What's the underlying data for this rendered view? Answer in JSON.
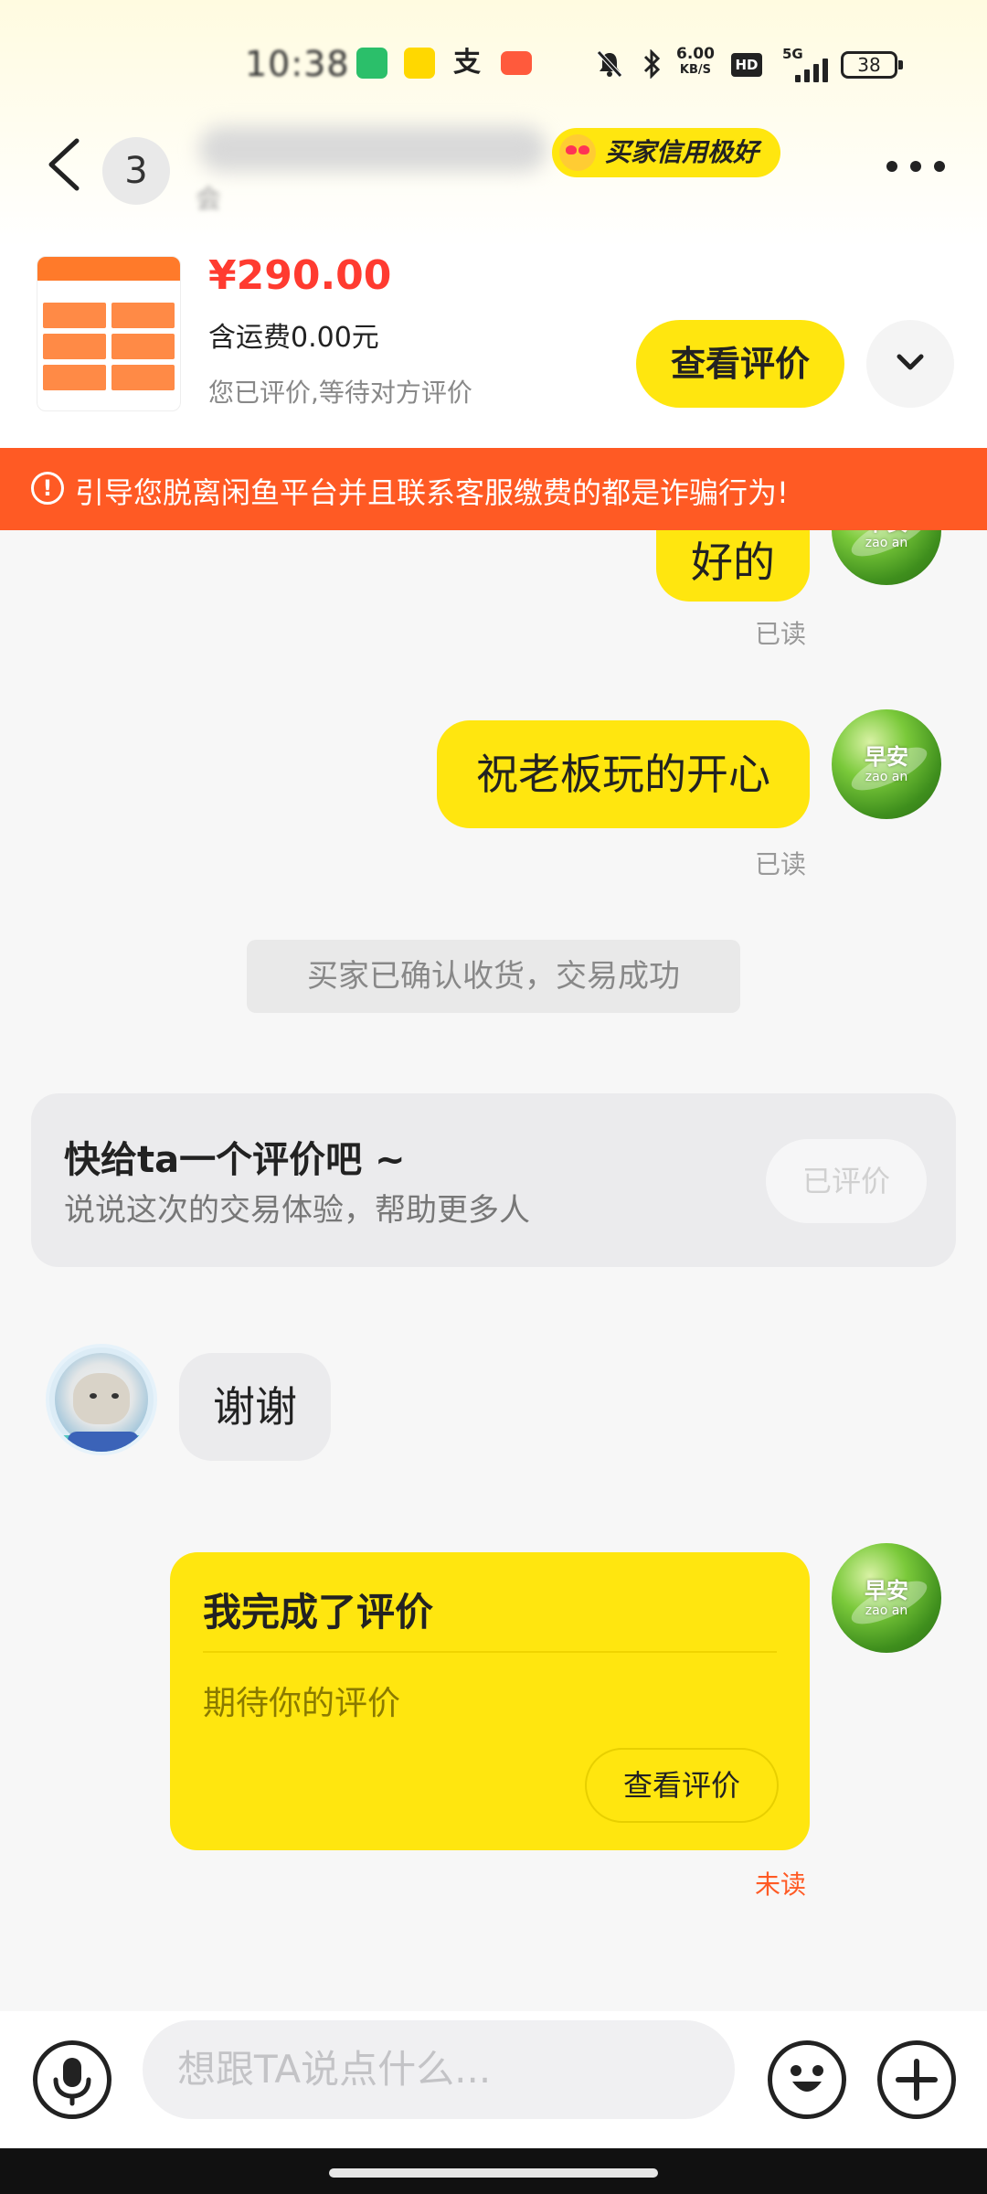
{
  "status_bar": {
    "time": "10:38",
    "net_speed_value": "6.00",
    "net_speed_unit": "KB/S",
    "hd_label": "HD",
    "network": "5G",
    "battery": "38"
  },
  "nav": {
    "unread_count": "3",
    "nickname_sub": "会",
    "credit_badge": "买家信用极好"
  },
  "product": {
    "price": "¥290.00",
    "shipping": "含运费0.00元",
    "status": "您已评价,等待对方评价",
    "view_review_label": "查看评价"
  },
  "warning": {
    "icon": "!",
    "text": "引导您脱离闲鱼平台并且联系客服缴费的都是诈骗行为!"
  },
  "messages": {
    "m1_text": "好的",
    "m1_read": "已读",
    "m2_text": "祝老板玩的开心",
    "m2_read": "已读",
    "avatar_me_text": "早安",
    "avatar_me_sub": "zao an",
    "system_msg": "买家已确认收货，交易成功",
    "review_prompt_title": "快给ta一个评价吧 ~",
    "review_prompt_sub": "说说这次的交易体验，帮助更多人",
    "review_prompt_button": "已评价",
    "m3_text": "谢谢",
    "done_card_title": "我完成了评价",
    "done_card_sub": "期待你的评价",
    "done_card_button": "查看评价",
    "done_card_status": "未读"
  },
  "input": {
    "placeholder": "想跟TA说点什么..."
  },
  "icons": {
    "back": "chevron-left-icon",
    "more": "more-dots-icon",
    "expand": "chevron-down-icon",
    "voice": "microphone-icon",
    "emoji": "emoji-icon",
    "add": "plus-icon"
  },
  "colors": {
    "accent_yellow": "#ffe60f",
    "warning_orange": "#ff5a24",
    "price_red": "#ff3b30"
  }
}
